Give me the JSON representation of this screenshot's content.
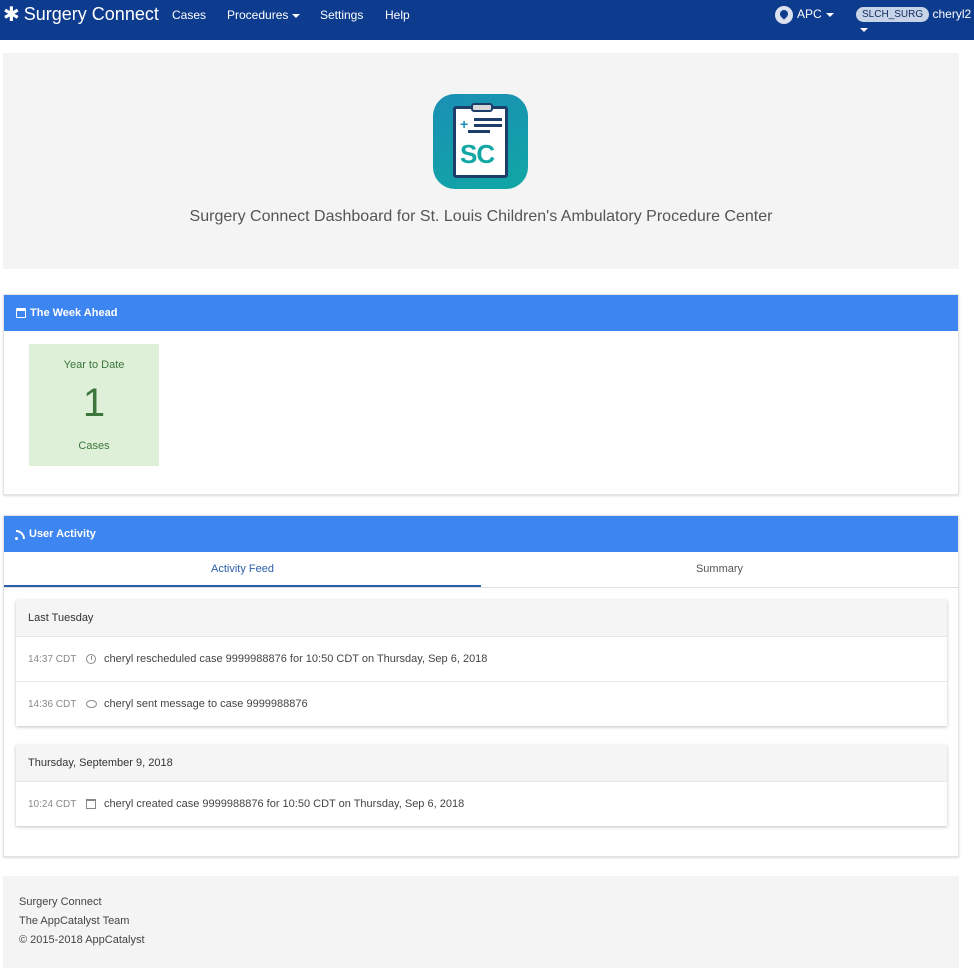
{
  "navbar": {
    "brand": "Surgery Connect",
    "items": [
      {
        "label": "Cases"
      },
      {
        "label": "Procedures"
      },
      {
        "label": "Settings"
      },
      {
        "label": "Help"
      }
    ],
    "location": "APC",
    "role_badge": "SLCH_SURG",
    "user": "cheryl2"
  },
  "hero": {
    "logo_text": "SC",
    "title": "Surgery Connect Dashboard for St. Louis Children's Ambulatory Procedure Center"
  },
  "week_ahead": {
    "title": "The Week Ahead",
    "stat": {
      "label_top": "Year to Date",
      "value": "1",
      "label_bottom": "Cases"
    }
  },
  "user_activity": {
    "title": "User Activity",
    "tabs": [
      {
        "label": "Activity Feed"
      },
      {
        "label": "Summary"
      }
    ],
    "groups": [
      {
        "heading": "Last Tuesday",
        "entries": [
          {
            "time": "14:37 CDT",
            "icon": "clock-icon",
            "text": "cheryl rescheduled case 9999988876 for 10:50 CDT on Thursday, Sep 6, 2018"
          },
          {
            "time": "14:36 CDT",
            "icon": "message-icon",
            "text": "cheryl sent message to case 9999988876"
          }
        ]
      },
      {
        "heading": "Thursday, September 9, 2018",
        "entries": [
          {
            "time": "10:24 CDT",
            "icon": "calendar-plus-icon",
            "text": "cheryl created case 9999988876 for 10:50 CDT on Thursday, Sep 6, 2018"
          }
        ]
      }
    ]
  },
  "footer": {
    "line1": "Surgery Connect",
    "line2": "The AppCatalyst Team",
    "line3": "© 2015-2018 AppCatalyst"
  },
  "colors": {
    "navbar": "#0d3b8e",
    "panel_header": "#3d85f0",
    "stat_bg": "#dff0d8",
    "stat_text": "#3c763d",
    "logo_teal": "#10a7a4"
  }
}
